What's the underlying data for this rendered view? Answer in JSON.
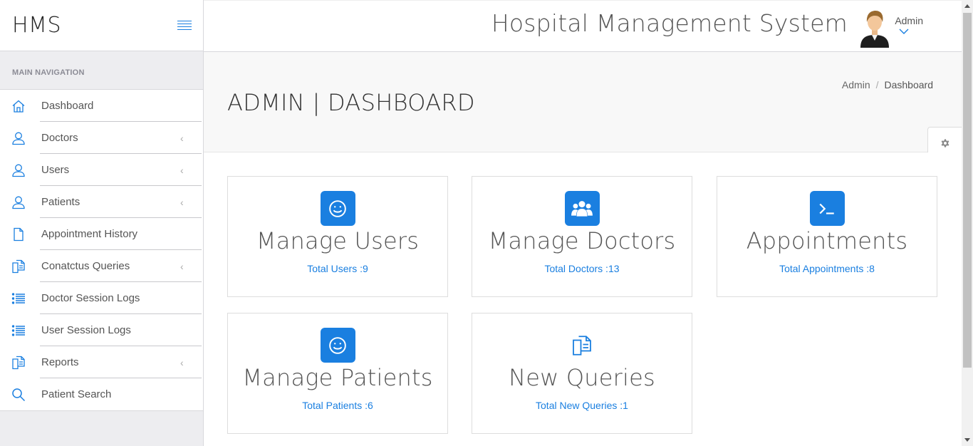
{
  "brand": "HMS",
  "sidebar": {
    "header": "MAIN NAVIGATION",
    "items": [
      {
        "label": "Dashboard",
        "icon": "home-icon",
        "chevron": false
      },
      {
        "label": "Doctors",
        "icon": "user-icon",
        "chevron": true
      },
      {
        "label": "Users",
        "icon": "user-icon",
        "chevron": true
      },
      {
        "label": "Patients",
        "icon": "user-icon",
        "chevron": true
      },
      {
        "label": "Appointment History",
        "icon": "file-icon",
        "chevron": false
      },
      {
        "label": "Conatctus Queries",
        "icon": "files-icon",
        "chevron": true
      },
      {
        "label": "Doctor Session Logs",
        "icon": "list-icon",
        "chevron": false
      },
      {
        "label": "User Session Logs",
        "icon": "list-icon",
        "chevron": false
      },
      {
        "label": "Reports",
        "icon": "files-icon",
        "chevron": true
      },
      {
        "label": "Patient Search",
        "icon": "search-icon",
        "chevron": false
      }
    ],
    "chevron_glyph": "‹"
  },
  "topbar": {
    "title": "Hospital Management System",
    "user": "Admin"
  },
  "page": {
    "title": "ADMIN | DASHBOARD",
    "breadcrumb": [
      "Admin",
      "/",
      "Dashboard"
    ]
  },
  "cards": [
    {
      "title": "Manage Users",
      "link": "Total Users :9",
      "icon": "smiley-icon"
    },
    {
      "title": "Manage Doctors",
      "link": "Total Doctors :13",
      "icon": "users-group-icon"
    },
    {
      "title": "Appointments",
      "link": "Total Appointments :8",
      "icon": "terminal-icon"
    },
    {
      "title": "Manage Patients",
      "link": "Total Patients :6",
      "icon": "smiley-icon"
    },
    {
      "title": "New Queries",
      "link": "Total New Queries :1",
      "icon": "files-icon"
    }
  ],
  "colors": {
    "accent": "#1a7fe0",
    "sidebar_bg": "#ededf0",
    "text": "#555555"
  }
}
